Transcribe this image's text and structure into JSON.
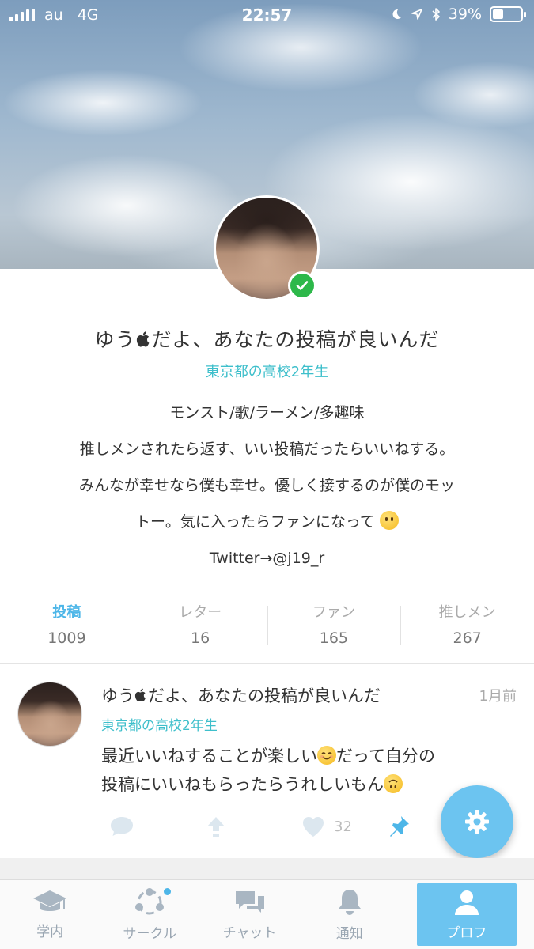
{
  "status_bar": {
    "carrier": "au",
    "network": "4G",
    "time": "22:57",
    "battery_percent": "39%",
    "battery_level": 0.39,
    "icons": [
      "signal-icon",
      "moon-icon",
      "location-icon",
      "bluetooth-icon",
      "battery-icon"
    ]
  },
  "profile": {
    "name": "ゆうだよ、あなたの投稿が良いんだ",
    "name_prefix": "ゆう",
    "name_suffix": "だよ、あなたの投稿が良いんだ",
    "school": "東京都の高校2年生",
    "verified": true,
    "bio_lines": [
      "モンスト/歌/ラーメン/多趣味",
      "推しメンされたら返す、いい投稿だったらいいねする。",
      "みんなが幸せなら僕も幸せ。優しく接するのが僕のモッ",
      "トー。気に入ったらファンになって",
      "Twitter→@j19_r"
    ]
  },
  "stats": [
    {
      "label": "投稿",
      "value": "1009",
      "active": true
    },
    {
      "label": "レター",
      "value": "16",
      "active": false
    },
    {
      "label": "ファン",
      "value": "165",
      "active": false
    },
    {
      "label": "推しメン",
      "value": "267",
      "active": false
    }
  ],
  "post": {
    "author_prefix": "ゆう",
    "author_suffix": "だよ、あなたの投稿が良いんだ",
    "time": "1月前",
    "school": "東京都の高校2年生",
    "body_line1_a": "最近いいねすることが楽しい",
    "body_line1_b": "だって自分の",
    "body_line2": "投稿にいいねもらったらうれしいもん",
    "like_count": "32"
  },
  "tabs": [
    {
      "label": "学内",
      "icon": "graduation-cap-icon"
    },
    {
      "label": "サークル",
      "icon": "circle-network-icon"
    },
    {
      "label": "チャット",
      "icon": "chat-bubbles-icon"
    },
    {
      "label": "通知",
      "icon": "bell-icon"
    },
    {
      "label": "プロフ",
      "icon": "person-icon"
    }
  ],
  "colors": {
    "accent": "#6cc4f0",
    "school_text": "#3ebfcb",
    "verified": "#2db84a"
  }
}
